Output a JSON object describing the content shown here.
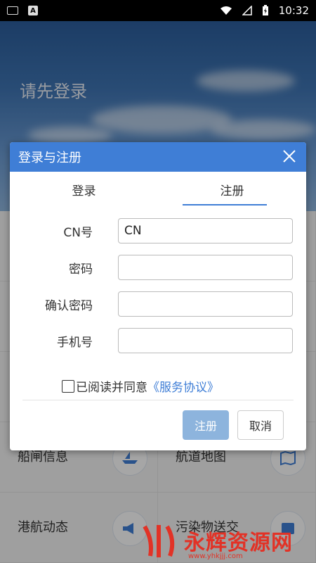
{
  "status_bar": {
    "time": "10:32"
  },
  "background": {
    "title": "请先登录",
    "tiles": [
      {
        "label": "船闸信息",
        "icon": "boat-icon"
      },
      {
        "label": "航道地图",
        "icon": "map-icon"
      },
      {
        "label": "港航动态",
        "icon": "megaphone-icon"
      },
      {
        "label": "污染物送交",
        "icon": "book-icon"
      }
    ]
  },
  "dialog": {
    "title": "登录与注册",
    "tabs": [
      "登录",
      "注册"
    ],
    "active_tab": "注册",
    "fields": [
      {
        "label": "CN号",
        "value": "CN",
        "placeholder": ""
      },
      {
        "label": "密码",
        "value": "",
        "placeholder": ""
      },
      {
        "label": "确认密码",
        "value": "",
        "placeholder": ""
      },
      {
        "label": "手机号",
        "value": "",
        "placeholder": ""
      }
    ],
    "agree_text": "已阅读并同意",
    "agree_link": "《服务协议》",
    "register_label": "注册",
    "cancel_label": "取消"
  },
  "watermark": {
    "text": "永辉资源网",
    "url": "www.yhkjjj.com"
  },
  "colors": {
    "accent": "#3f7ed6",
    "register_button": "#8db4dd"
  }
}
